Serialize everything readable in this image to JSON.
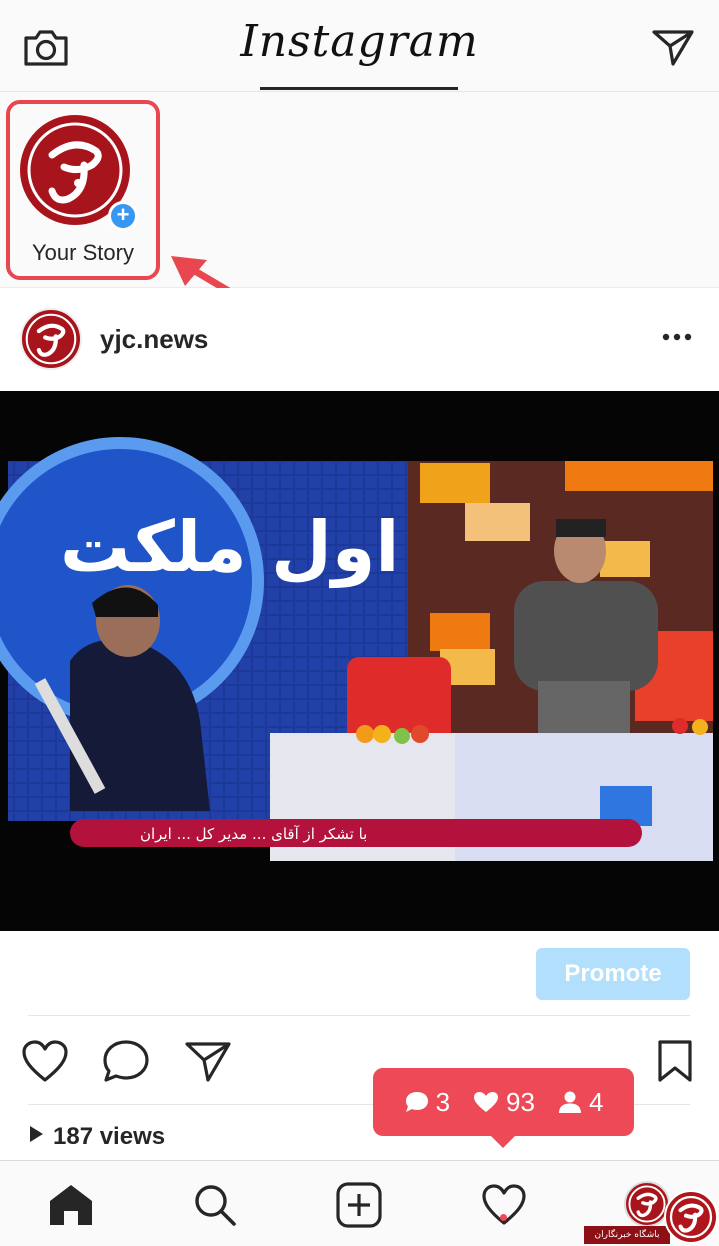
{
  "header": {
    "logo": "Instagram",
    "left_icon": "camera-icon",
    "right_icon": "direct-send-icon"
  },
  "stories": {
    "items": [
      {
        "label": "Your Story",
        "icon": "add-story-plus-icon"
      }
    ]
  },
  "post": {
    "username": "yjc.news",
    "menu_icon": "more-horizontal-icon",
    "media": {
      "logo_text": "اول ملکت",
      "ticker_text": "با تشکر از آقای ... مدیر کل ... ایران"
    },
    "promote_label": "Promote",
    "actions": [
      "heart-icon",
      "comment-icon",
      "share-icon",
      "bookmark-icon"
    ],
    "views": "187 views"
  },
  "activity": {
    "comments": "3",
    "likes": "93",
    "followers": "4"
  },
  "nav": {
    "items": [
      "home-icon",
      "search-icon",
      "new-post-icon",
      "activity-heart-icon",
      "profile-avatar"
    ]
  },
  "watermark": {
    "text": "باشگاه خبرنگاران"
  },
  "colors": {
    "accent_red": "#ed4956",
    "story_outline": "#e8474f",
    "promote_bg": "#b2dffc",
    "brand_red": "#a8141c",
    "plus_blue": "#3897f0"
  }
}
